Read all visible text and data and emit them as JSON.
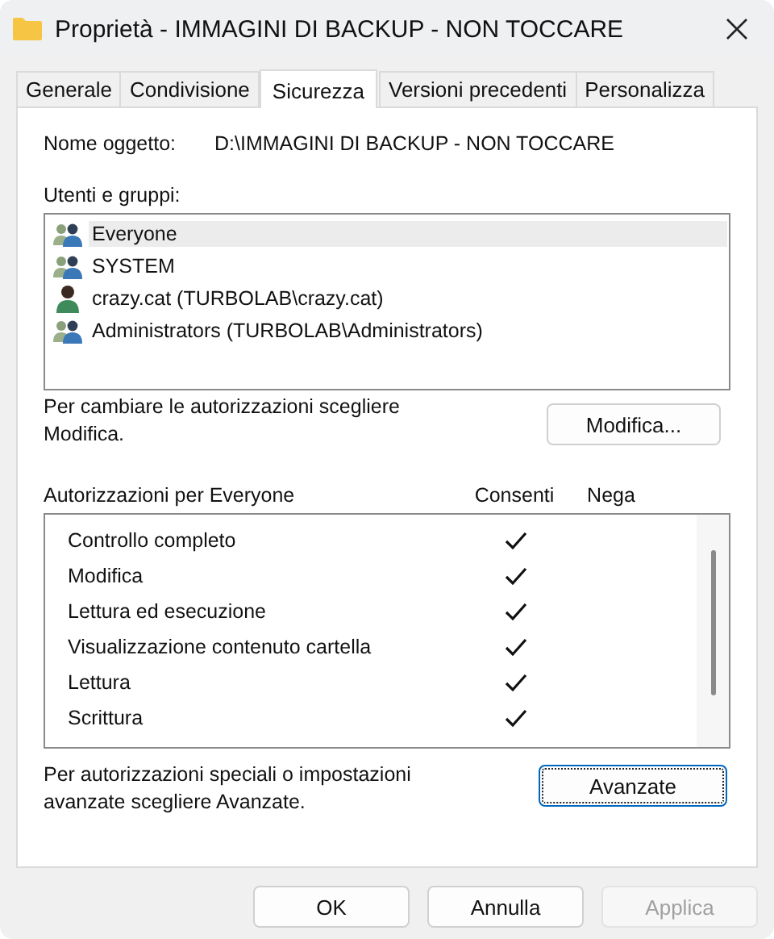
{
  "window": {
    "title": "Proprietà - IMMAGINI DI BACKUP - NON TOCCARE"
  },
  "tabs": [
    {
      "label": "Generale",
      "selected": false
    },
    {
      "label": "Condivisione",
      "selected": false
    },
    {
      "label": "Sicurezza",
      "selected": true
    },
    {
      "label": "Versioni precedenti",
      "selected": false
    },
    {
      "label": "Personalizza",
      "selected": false
    }
  ],
  "object_name": {
    "label": "Nome oggetto:",
    "value": "D:\\IMMAGINI DI BACKUP - NON TOCCARE"
  },
  "users_label": "Utenti e gruppi:",
  "users": [
    {
      "name": "Everyone",
      "kind": "group",
      "selected": true
    },
    {
      "name": "SYSTEM",
      "kind": "group",
      "selected": false
    },
    {
      "name": "crazy.cat (TURBOLAB\\crazy.cat)",
      "kind": "user",
      "selected": false
    },
    {
      "name": "Administrators (TURBOLAB\\Administrators)",
      "kind": "group",
      "selected": false
    }
  ],
  "edit_hint": "Per cambiare le autorizzazioni scegliere Modifica.",
  "edit_button": "Modifica...",
  "permissions_header": {
    "title": "Autorizzazioni per Everyone",
    "allow": "Consenti",
    "deny": "Nega"
  },
  "permissions": [
    {
      "name": "Controllo completo",
      "allow": true,
      "deny": false
    },
    {
      "name": "Modifica",
      "allow": true,
      "deny": false
    },
    {
      "name": "Lettura ed esecuzione",
      "allow": true,
      "deny": false
    },
    {
      "name": "Visualizzazione contenuto cartella",
      "allow": true,
      "deny": false
    },
    {
      "name": "Lettura",
      "allow": true,
      "deny": false
    },
    {
      "name": "Scrittura",
      "allow": true,
      "deny": false
    }
  ],
  "advanced_hint": "Per autorizzazioni speciali o impostazioni avanzate scegliere Avanzate.",
  "advanced_button": {
    "label": "Avanzate",
    "focused": true
  },
  "buttons": [
    {
      "label": "OK",
      "disabled": false
    },
    {
      "label": "Annulla",
      "disabled": false
    },
    {
      "label": "Applica",
      "disabled": true
    }
  ]
}
